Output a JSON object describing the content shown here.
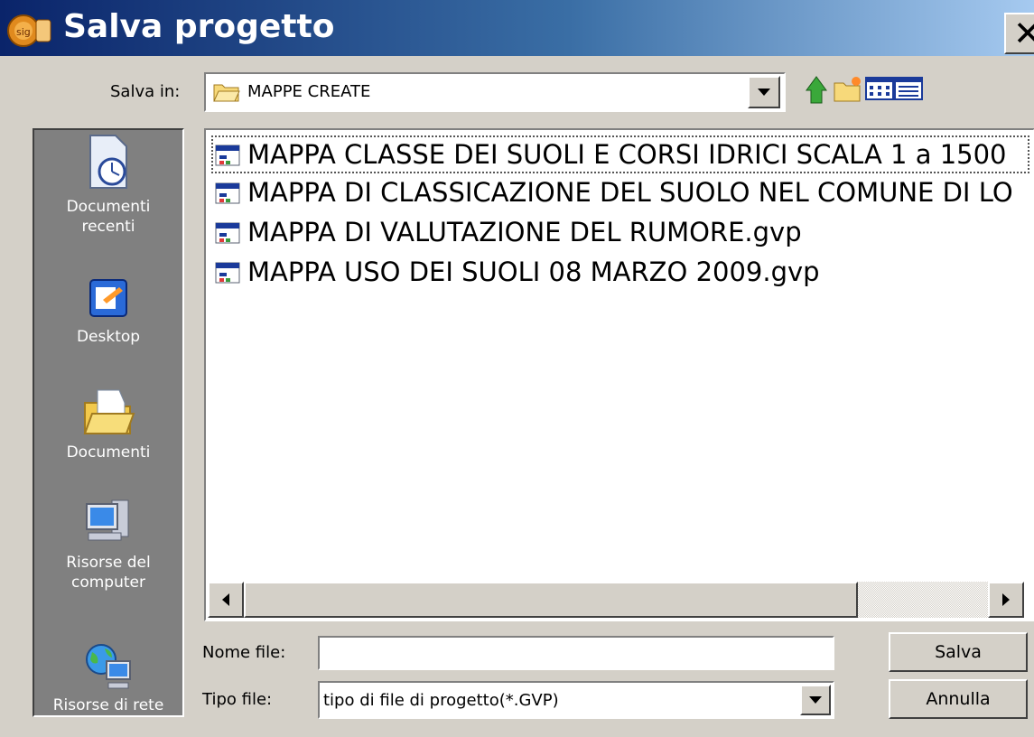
{
  "window": {
    "title": "Salva progetto",
    "close_label": "✕"
  },
  "lookin": {
    "label": "Salva in:",
    "value": "MAPPE CREATE"
  },
  "toolbar": {
    "icons": [
      "up-folder-icon",
      "new-folder-icon",
      "list-view-icon",
      "details-view-icon"
    ]
  },
  "places": [
    {
      "label": "Documenti\nrecenti",
      "icon": "recent-documents-icon"
    },
    {
      "label": "Desktop",
      "icon": "desktop-icon"
    },
    {
      "label": "Documenti",
      "icon": "documents-folder-icon"
    },
    {
      "label": "Risorse del\ncomputer",
      "icon": "my-computer-icon"
    },
    {
      "label": "Risorse di rete",
      "icon": "network-icon"
    }
  ],
  "files": [
    "MAPPA CLASSE DEI SUOLI E CORSI IDRICI SCALA 1 a 1500",
    "MAPPA DI CLASSICAZIONE DEL SUOLO NEL COMUNE DI LO",
    "MAPPA DI VALUTAZIONE DEL RUMORE.gvp",
    "MAPPA USO DEI SUOLI 08 MARZO 2009.gvp"
  ],
  "filename": {
    "label": "Nome file:",
    "value": ""
  },
  "filetype": {
    "label": "Tipo file:",
    "value": "tipo di file di progetto(*.GVP)"
  },
  "buttons": {
    "save": "Salva",
    "cancel": "Annulla"
  }
}
